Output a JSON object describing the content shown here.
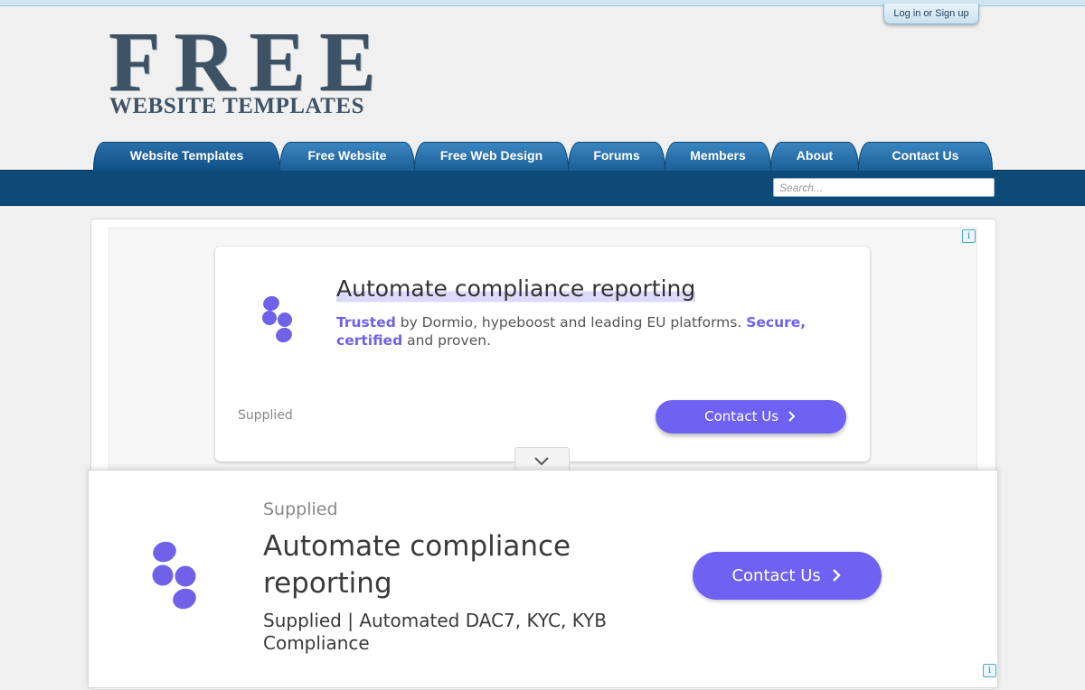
{
  "header": {
    "login_label": "Log in or Sign up",
    "logo": {
      "title": "FREE",
      "subtitle": "WEBSITE TEMPLATES"
    }
  },
  "nav": {
    "tabs": [
      {
        "label": "Website Templates",
        "active": true
      },
      {
        "label": "Free Website"
      },
      {
        "label": "Free Web Design"
      },
      {
        "label": "Forums"
      },
      {
        "label": "Members"
      },
      {
        "label": "About"
      },
      {
        "label": "Contact Us"
      }
    ],
    "search_placeholder": "Search..."
  },
  "ad_top": {
    "title": "Automate compliance reporting",
    "desc_parts": [
      "Trusted",
      " by Dormio, hypeboost and leading EU platforms. ",
      "Secure, certified",
      " and proven."
    ],
    "supplied": "Supplied",
    "button": "Contact Us",
    "info_icon": "info-icon",
    "expand_icon": "chevron-down-icon"
  },
  "ad_bottom": {
    "supplied": "Supplied",
    "title": "Automate compliance reporting",
    "desc": "Supplied | Automated DAC7, KYC, KYB Compliance",
    "button": "Contact Us",
    "info_icon": "info-icon"
  },
  "colors": {
    "accent": "#6f62f2",
    "nav_bar": "#0d4a78",
    "tab": "#2a6fa8",
    "logo": "#3e5265"
  }
}
